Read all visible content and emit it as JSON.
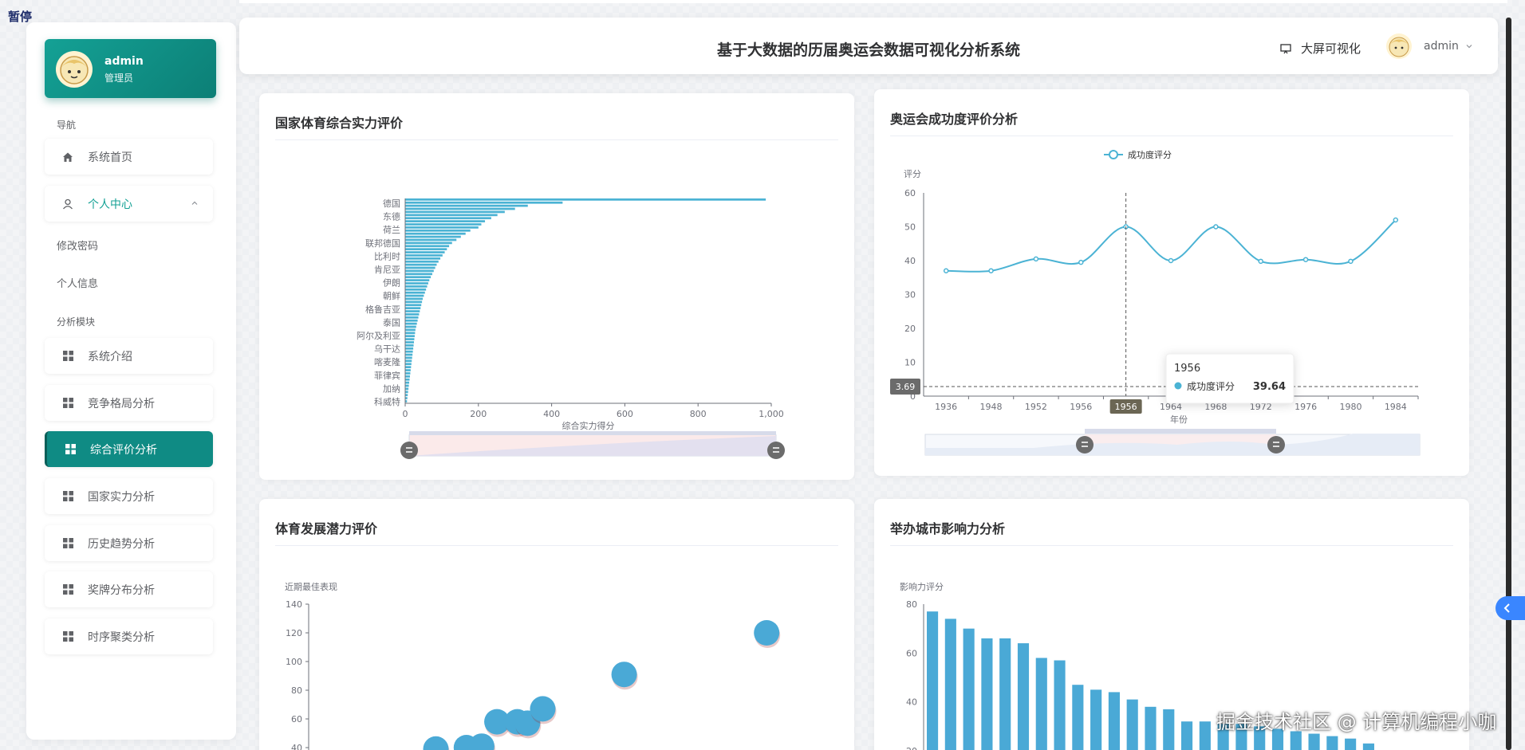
{
  "overlay": {
    "pause_label": "暂停",
    "watermark": "掘金技术社区 @ 计算机编程小咖"
  },
  "sidebar": {
    "user_name": "admin",
    "user_role": "管理员",
    "nav_section": "导航",
    "items": [
      {
        "label": "系统首页",
        "icon": "home-icon"
      },
      {
        "label": "个人中心",
        "icon": "user-icon",
        "expanded": true,
        "children": [
          {
            "label": "修改密码"
          },
          {
            "label": "个人信息"
          }
        ]
      }
    ],
    "analysis_section": "分析模块",
    "modules": [
      {
        "label": "系统介绍",
        "icon": "grid-icon"
      },
      {
        "label": "竞争格局分析",
        "icon": "grid-icon"
      },
      {
        "label": "综合评价分析",
        "icon": "grid-icon",
        "active": true
      },
      {
        "label": "国家实力分析",
        "icon": "grid-icon"
      },
      {
        "label": "历史趋势分析",
        "icon": "grid-icon"
      },
      {
        "label": "奖牌分布分析",
        "icon": "grid-icon"
      },
      {
        "label": "时序聚类分析",
        "icon": "grid-icon"
      }
    ]
  },
  "header": {
    "title": "基于大数据的历届奥运会数据可视化分析系统",
    "bigscreen_label": "大屏可视化",
    "user_label": "admin"
  },
  "colors": {
    "accent": "#0f8b84",
    "chart_blue": "#4bb3d4",
    "bar_blue": "#4aa9d6"
  },
  "panels": {
    "country_strength": {
      "title": "国家体育综合实力评价"
    },
    "olympic_success": {
      "title": "奥运会成功度评价分析"
    },
    "potential": {
      "title": "体育发展潜力评价"
    },
    "city_influence": {
      "title": "举办城市影响力分析"
    }
  },
  "chart_data": [
    {
      "id": "country_strength",
      "type": "bar",
      "orientation": "horizontal",
      "xlabel": "综合实力得分",
      "xlim": [
        0,
        1000
      ],
      "xticks": [
        "0",
        "200",
        "400",
        "600",
        "800",
        "1,000"
      ],
      "category_labels": [
        "德国",
        "东德",
        "荷兰",
        "联邦德国",
        "比利时",
        "肯尼亚",
        "伊朗",
        "朝鲜",
        "格鲁吉亚",
        "泰国",
        "阿尔及利亚",
        "乌干达",
        "喀麦隆",
        "菲律宾",
        "加纳",
        "科威特"
      ],
      "values": [
        985,
        430,
        335,
        300,
        272,
        252,
        235,
        218,
        208,
        200,
        178,
        165,
        152,
        140,
        128,
        120,
        114,
        108,
        102,
        96,
        91,
        86,
        82,
        78,
        74,
        70,
        66,
        63,
        60,
        57,
        54,
        51,
        48,
        46,
        44,
        42,
        40,
        38,
        36,
        34,
        32,
        30,
        28,
        27,
        26,
        25,
        24,
        23,
        22,
        21,
        20,
        19,
        18,
        17,
        16,
        15,
        14,
        13,
        12,
        11,
        10,
        9,
        8,
        7,
        6,
        5
      ],
      "zoom": true
    },
    {
      "id": "olympic_success",
      "type": "line",
      "legend": "成功度评分",
      "ylabel": "评分",
      "xlabel": "年份",
      "ylim": [
        0,
        60
      ],
      "yticks": [
        0,
        10,
        20,
        30,
        40,
        50,
        60
      ],
      "x": [
        "1936",
        "1948",
        "1952",
        "1956",
        "1956",
        "1964",
        "1968",
        "1972",
        "1976",
        "1980",
        "1984"
      ],
      "values": [
        37,
        37,
        40.5,
        39.5,
        50,
        40,
        50,
        39.8,
        40.3,
        39.8,
        52
      ],
      "tooltip": {
        "title": "1956",
        "series": "成功度评分",
        "value": "39.64"
      },
      "axis_pointer_y": "3.69",
      "highlight_x": "1956",
      "zoom": true
    },
    {
      "id": "potential",
      "type": "scatter",
      "ylabel": "近期最佳表现",
      "ylim": [
        40,
        140
      ],
      "yticks": [
        40,
        60,
        80,
        100,
        120,
        140
      ],
      "points": [
        {
          "x": 0.25,
          "y": 39
        },
        {
          "x": 0.31,
          "y": 40
        },
        {
          "x": 0.34,
          "y": 41
        },
        {
          "x": 0.37,
          "y": 58
        },
        {
          "x": 0.41,
          "y": 58
        },
        {
          "x": 0.43,
          "y": 57
        },
        {
          "x": 0.46,
          "y": 67
        },
        {
          "x": 0.62,
          "y": 91
        },
        {
          "x": 0.9,
          "y": 120
        }
      ]
    },
    {
      "id": "city_influence",
      "type": "bar",
      "ylabel": "影响力评分",
      "ylim": [
        20,
        80
      ],
      "yticks": [
        20,
        40,
        60,
        80
      ],
      "values": [
        77,
        74,
        70,
        66,
        66,
        64,
        58,
        57,
        47,
        45,
        44,
        41,
        38,
        37,
        32,
        32,
        31,
        31,
        30,
        29,
        28,
        27,
        26,
        25,
        23,
        20
      ]
    }
  ]
}
